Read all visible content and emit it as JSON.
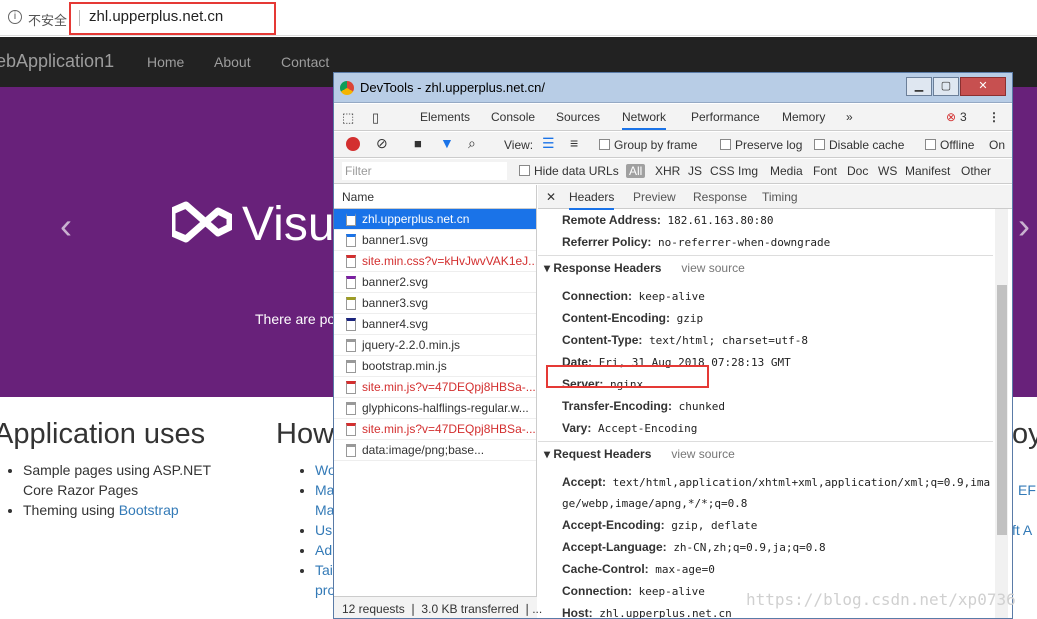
{
  "browser": {
    "insecure": "不安全",
    "url": "zhl.upperplus.net.cn",
    "info_icon": "info-icon"
  },
  "site": {
    "brand": "ebApplication1",
    "nav": [
      "Home",
      "About",
      "Contact"
    ],
    "banner_text": "Visua",
    "caption": "There are po",
    "left_arrow": "‹",
    "right_arrow": "›",
    "col1": {
      "title": "Application uses",
      "items": [
        {
          "a": "Sample pages using ASP.NET",
          "b": "Core Razor Pages"
        },
        {
          "pre": "Theming using ",
          "link": "Bootstrap"
        }
      ]
    },
    "col2": {
      "title": "How",
      "items": [
        "Wo",
        "Ma",
        "Ma",
        "Us",
        "Ad",
        "Tai",
        "pro"
      ]
    },
    "col3": {
      "title": "oy",
      "items": [
        "EF",
        "ft A"
      ]
    }
  },
  "devtools": {
    "title": "DevTools - zhl.upperplus.net.cn/",
    "tabs": [
      "Elements",
      "Console",
      "Sources",
      "Network",
      "Performance",
      "Memory",
      "»"
    ],
    "active_tab": "Network",
    "errors": "3",
    "toolbar": {
      "view": "View:",
      "group": "Group by frame",
      "preserve": "Preserve log",
      "disable": "Disable cache",
      "offline": "Offline",
      "online": "On"
    },
    "filter": {
      "placeholder": "Filter",
      "hide": "Hide data URLs",
      "types": [
        "All",
        "XHR",
        "JS",
        "CSS",
        "Img",
        "Media",
        "Font",
        "Doc",
        "WS",
        "Manifest",
        "Other"
      ]
    },
    "list_header": "Name",
    "requests": [
      {
        "name": "zhl.upperplus.net.cn",
        "state": "sel"
      },
      {
        "name": "banner1.svg",
        "state": ""
      },
      {
        "name": "site.min.css?v=kHvJwvVAK1eJ...",
        "state": "red"
      },
      {
        "name": "banner2.svg",
        "state": ""
      },
      {
        "name": "banner3.svg",
        "state": ""
      },
      {
        "name": "banner4.svg",
        "state": ""
      },
      {
        "name": "jquery-2.2.0.min.js",
        "state": ""
      },
      {
        "name": "bootstrap.min.js",
        "state": ""
      },
      {
        "name": "site.min.js?v=47DEQpj8HBSa-...",
        "state": "red"
      },
      {
        "name": "glyphicons-halflings-regular.w...",
        "state": ""
      },
      {
        "name": "site.min.js?v=47DEQpj8HBSa-...",
        "state": "red"
      },
      {
        "name": "data:image/png;base...",
        "state": ""
      }
    ],
    "summary": "12 requests ❘ 3.0 KB transferred ❘...",
    "detail_tabs": [
      "Headers",
      "Preview",
      "Response",
      "Timing"
    ],
    "general": [
      {
        "k": "Remote Address:",
        "v": "182.61.163.80:80"
      },
      {
        "k": "Referrer Policy:",
        "v": "no-referrer-when-downgrade"
      }
    ],
    "response_title": "Response Headers",
    "view_source": "view source",
    "response": [
      {
        "k": "Connection:",
        "v": "keep-alive"
      },
      {
        "k": "Content-Encoding:",
        "v": "gzip"
      },
      {
        "k": "Content-Type:",
        "v": "text/html; charset=utf-8"
      },
      {
        "k": "Date:",
        "v": "Fri, 31 Aug 2018 07:28:13 GMT"
      },
      {
        "k": "Server:",
        "v": "nginx"
      },
      {
        "k": "Transfer-Encoding:",
        "v": "chunked"
      },
      {
        "k": "Vary:",
        "v": "Accept-Encoding"
      }
    ],
    "request_title": "Request Headers",
    "request": [
      {
        "k": "Accept:",
        "v": "text/html,application/xhtml+xml,application/xml;q=0.9,ima"
      },
      {
        "k": "",
        "v": "ge/webp,image/apng,*/*;q=0.8"
      },
      {
        "k": "Accept-Encoding:",
        "v": "gzip, deflate"
      },
      {
        "k": "Accept-Language:",
        "v": "zh-CN,zh;q=0.9,ja;q=0.8"
      },
      {
        "k": "Cache-Control:",
        "v": "max-age=0"
      },
      {
        "k": "Connection:",
        "v": "keep-alive"
      },
      {
        "k": "Host:",
        "v": "zhl.upperplus.net.cn"
      }
    ]
  },
  "watermark": "https://blog.csdn.net/xp0736"
}
